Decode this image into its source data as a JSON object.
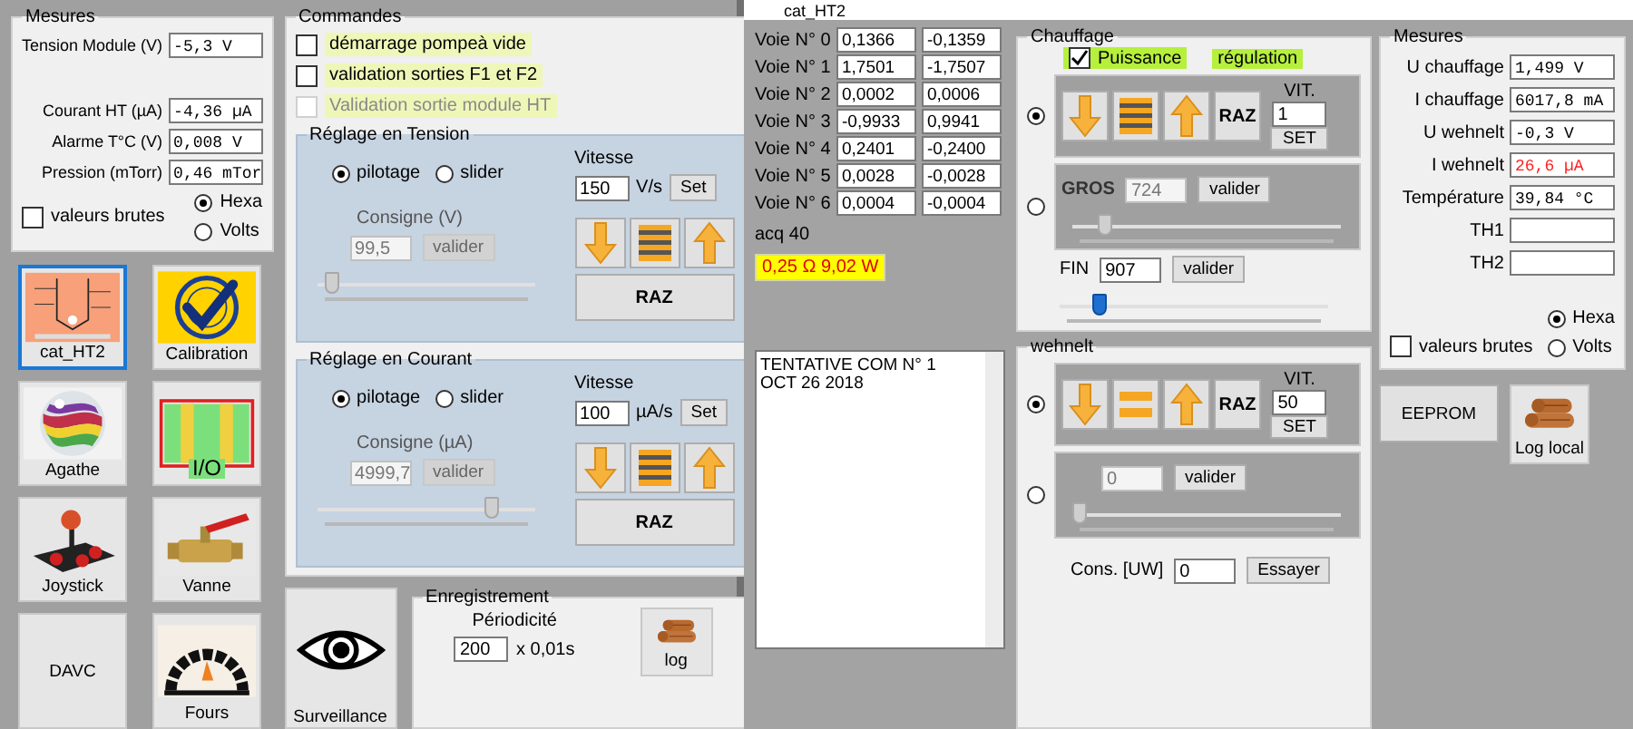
{
  "left_window": {
    "mesures": {
      "title": "Mesures",
      "fields": [
        {
          "label": "Tension Module (V)",
          "value": "-5,3 V"
        },
        {
          "label": "Courant HT (µA)",
          "value": "-4,36 µA"
        },
        {
          "label": "Alarme T°C (V)",
          "value": "0,008 V"
        },
        {
          "label": "Pression (mTorr)",
          "value": "0,46 mTor"
        }
      ],
      "raw_values": {
        "label": "valeurs brutes",
        "checked": false
      },
      "modes": [
        {
          "label": "Hexa",
          "selected": true
        },
        {
          "label": "Volts",
          "selected": false
        }
      ]
    },
    "tiles": [
      {
        "label": "cat_HT2",
        "kind": "diagram",
        "selected": true
      },
      {
        "label": "Calibration",
        "kind": "seal",
        "selected": false
      },
      {
        "label": "Agathe",
        "kind": "marble",
        "selected": false
      },
      {
        "badge": "I/O",
        "kind": "io",
        "selected": false
      },
      {
        "label": "Joystick",
        "kind": "joystick",
        "selected": false
      },
      {
        "label": "Vanne",
        "kind": "valve",
        "selected": false
      },
      {
        "label": "DAVC",
        "kind": "none",
        "selected": false
      },
      {
        "label": "Fours",
        "kind": "oven",
        "selected": false
      }
    ],
    "commandes": {
      "title": "Commandes",
      "checks": [
        {
          "label": "démarrage pompeà vide",
          "checked": false,
          "disabled": false
        },
        {
          "label": "validation sorties F1 et F2",
          "checked": false,
          "disabled": false
        },
        {
          "label": "Validation sortie module HT",
          "checked": false,
          "disabled": true
        }
      ]
    },
    "reglages": [
      {
        "title": "Réglage en Tension",
        "modes": [
          {
            "label": "pilotage",
            "selected": true
          },
          {
            "label": "slider",
            "selected": false
          }
        ],
        "consigne_label": "Consigne (V)",
        "consigne_value": "99,5",
        "disabled": true,
        "validate": "valider",
        "level": 0.04,
        "speed_label": "Vitesse",
        "speed_value": "150",
        "speed_unit": "V/s",
        "set": "Set",
        "reset": "RAZ"
      },
      {
        "title": "Réglage en Courant",
        "modes": [
          {
            "label": "pilotage",
            "selected": true
          },
          {
            "label": "slider",
            "selected": false
          }
        ],
        "consigne_label": "Consigne (µA)",
        "consigne_value": "4999,7",
        "disabled": true,
        "validate": "valider",
        "level": 0.83,
        "speed_label": "Vitesse",
        "speed_value": "100",
        "speed_unit": "µA/s",
        "set": "Set",
        "reset": "RAZ"
      }
    ],
    "surveillance": {
      "label": "Surveillance",
      "kind": "eye"
    },
    "enregistrement": {
      "title": "Enregistrement",
      "period_label": "Périodicité",
      "period_value": "200",
      "period_unit": "x 0,01s",
      "log_button": {
        "label": "log",
        "kind": "logs"
      }
    }
  },
  "right_window": {
    "title": "cat_HT2",
    "voies": [
      {
        "label": "Voie N° 0",
        "a": "0,1366",
        "b": "-0,1359"
      },
      {
        "label": "Voie N° 1",
        "a": "1,7501",
        "b": "-1,7507"
      },
      {
        "label": "Voie N° 2",
        "a": "0,0002",
        "b": "0,0006"
      },
      {
        "label": "Voie N° 3",
        "a": "-0,9933",
        "b": "0,9941"
      },
      {
        "label": "Voie N° 4",
        "a": "0,2401",
        "b": "-0,2400"
      },
      {
        "label": "Voie N° 5",
        "a": "0,0028",
        "b": "-0,0028"
      },
      {
        "label": "Voie N° 6",
        "a": "0,0004",
        "b": "-0,0004"
      }
    ],
    "acq": "acq 40",
    "power": "0,25 Ω 9,02 W",
    "log_lines": [
      "TENTATIVE COM N° 1",
      "OCT 26 2018"
    ],
    "chauffage": {
      "title": "Chauffage",
      "power": {
        "label": "Puissance",
        "checked": true
      },
      "regulation": "régulation",
      "step": {
        "selected": true,
        "reset": "RAZ",
        "speed_label": "VIT.",
        "speed_value": "1",
        "set": "SET"
      },
      "coarse": {
        "selected": false,
        "label": "GROS",
        "value": "724",
        "disabled": true,
        "validate": "valider",
        "level": 0.1
      },
      "fine": {
        "label": "FIN",
        "value": "907",
        "validate": "valider",
        "level": 0.13
      }
    },
    "wehnelt": {
      "title": "wehnelt",
      "step": {
        "selected": true,
        "reset": "RAZ",
        "speed_label": "VIT.",
        "speed_value": "50",
        "set": "SET"
      },
      "manual": {
        "selected": false,
        "value": "0",
        "disabled": true,
        "validate": "valider",
        "level": 0
      },
      "command": {
        "label": "Cons. [UW]",
        "value": "0",
        "button": "Essayer"
      }
    },
    "mesures": {
      "title": "Mesures",
      "fields": [
        {
          "label": "U chauffage",
          "value": "1,499 V",
          "alarm": false
        },
        {
          "label": "I chauffage",
          "value": "6017,8 mA",
          "alarm": false
        },
        {
          "label": "U wehnelt",
          "value": "-0,3 V",
          "alarm": false
        },
        {
          "label": "I wehnelt",
          "value": "26,6 µA",
          "alarm": true
        },
        {
          "label": "Température",
          "value": "39,84 °C",
          "alarm": false
        },
        {
          "label": "TH1"
        },
        {
          "label": "TH2"
        }
      ],
      "raw_values": {
        "label": "valeurs brutes",
        "checked": false
      },
      "modes": [
        {
          "label": "Hexa",
          "selected": true
        },
        {
          "label": "Volts",
          "selected": false
        }
      ]
    },
    "eeprom": "EEPROM",
    "log_local": {
      "label": "Log local",
      "kind": "logs"
    }
  }
}
